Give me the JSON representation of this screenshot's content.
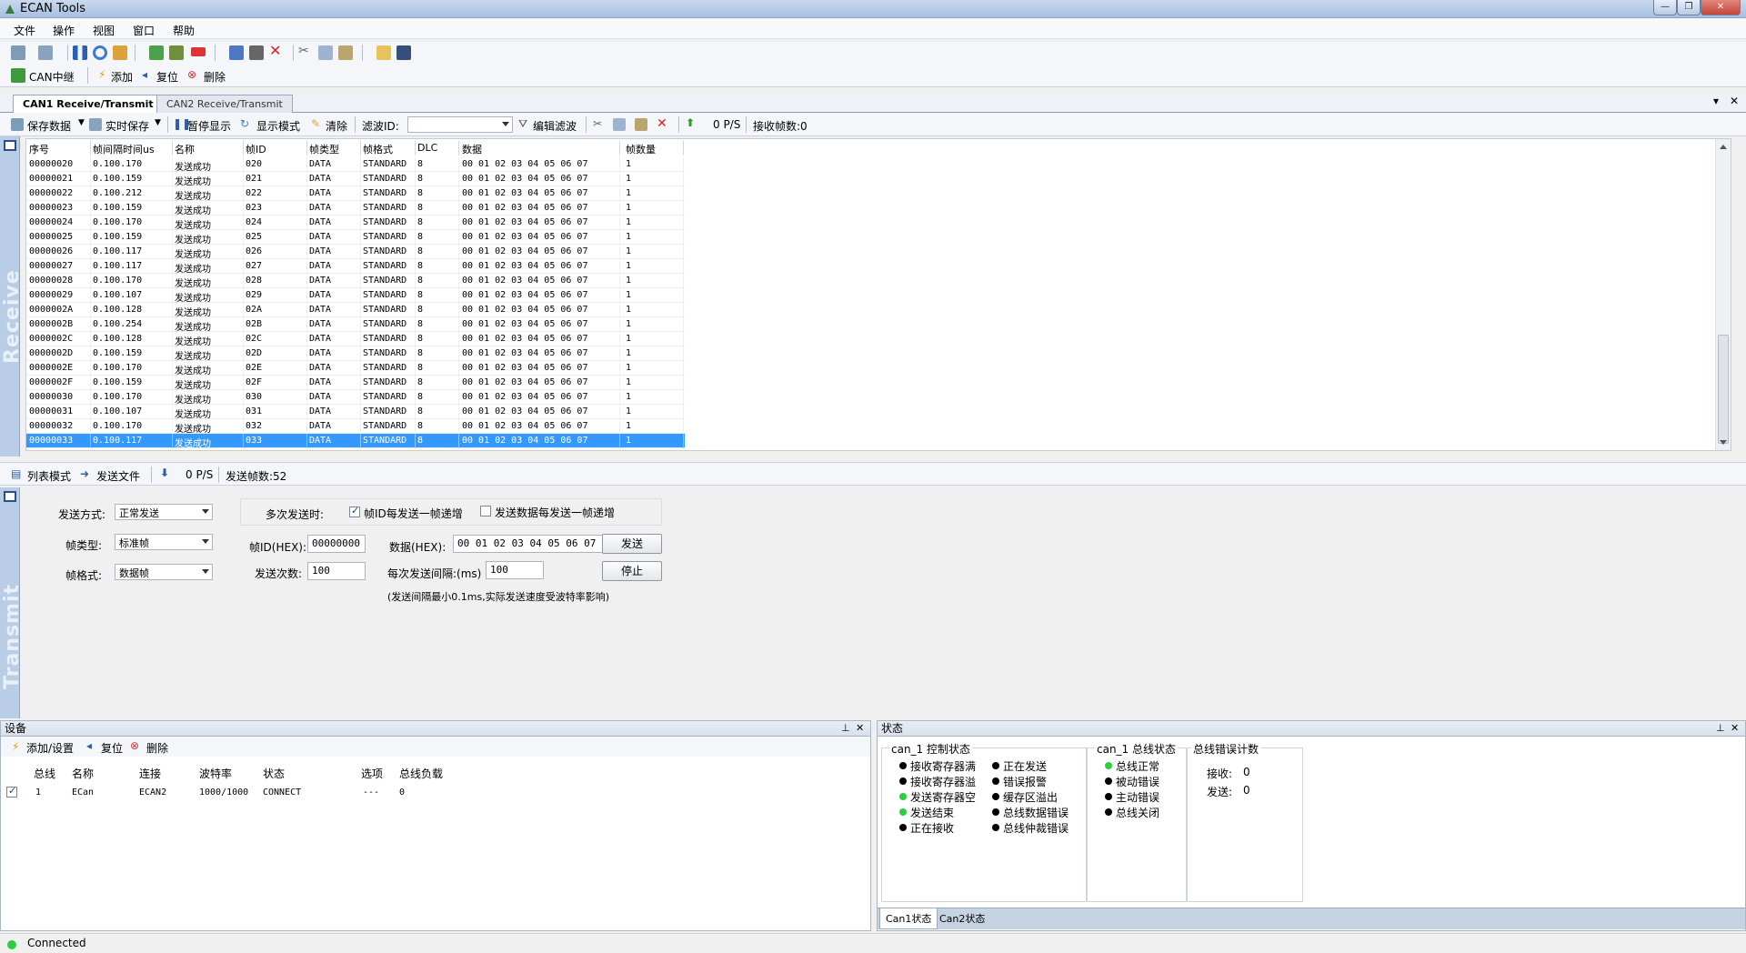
{
  "window": {
    "title": "ECAN Tools"
  },
  "menu": [
    "文件",
    "操作",
    "视图",
    "窗口",
    "帮助"
  ],
  "toolbar2": {
    "can_relay": "CAN中继",
    "add": "添加",
    "reset": "复位",
    "delete": "删除"
  },
  "tabs": {
    "active": "CAN1 Receive/Transmit",
    "inactive": "CAN2 Receive/Transmit"
  },
  "receive_toolbar": {
    "save_data": "保存数据",
    "realtime_save": "实时保存",
    "pause_display": "暂停显示",
    "display_mode": "显示模式",
    "clear": "清除",
    "filter_id_label": "滤波ID:",
    "edit_filter": "编辑滤波",
    "rate": "0 P/S",
    "received_frames": "接收帧数:0"
  },
  "side_labels": {
    "receive": "Receive",
    "transmit": "Transmit"
  },
  "receive_grid": {
    "headers": [
      "序号",
      "帧间隔时间us",
      "名称",
      "帧ID",
      "帧类型",
      "帧格式",
      "DLC",
      "数据",
      "帧数量"
    ],
    "rows": [
      [
        "00000020",
        "0.100.170",
        "发送成功",
        "020",
        "DATA",
        "STANDARD",
        "8",
        "00 01 02 03 04 05 06 07",
        "1"
      ],
      [
        "00000021",
        "0.100.159",
        "发送成功",
        "021",
        "DATA",
        "STANDARD",
        "8",
        "00 01 02 03 04 05 06 07",
        "1"
      ],
      [
        "00000022",
        "0.100.212",
        "发送成功",
        "022",
        "DATA",
        "STANDARD",
        "8",
        "00 01 02 03 04 05 06 07",
        "1"
      ],
      [
        "00000023",
        "0.100.159",
        "发送成功",
        "023",
        "DATA",
        "STANDARD",
        "8",
        "00 01 02 03 04 05 06 07",
        "1"
      ],
      [
        "00000024",
        "0.100.170",
        "发送成功",
        "024",
        "DATA",
        "STANDARD",
        "8",
        "00 01 02 03 04 05 06 07",
        "1"
      ],
      [
        "00000025",
        "0.100.159",
        "发送成功",
        "025",
        "DATA",
        "STANDARD",
        "8",
        "00 01 02 03 04 05 06 07",
        "1"
      ],
      [
        "00000026",
        "0.100.117",
        "发送成功",
        "026",
        "DATA",
        "STANDARD",
        "8",
        "00 01 02 03 04 05 06 07",
        "1"
      ],
      [
        "00000027",
        "0.100.117",
        "发送成功",
        "027",
        "DATA",
        "STANDARD",
        "8",
        "00 01 02 03 04 05 06 07",
        "1"
      ],
      [
        "00000028",
        "0.100.170",
        "发送成功",
        "028",
        "DATA",
        "STANDARD",
        "8",
        "00 01 02 03 04 05 06 07",
        "1"
      ],
      [
        "00000029",
        "0.100.107",
        "发送成功",
        "029",
        "DATA",
        "STANDARD",
        "8",
        "00 01 02 03 04 05 06 07",
        "1"
      ],
      [
        "0000002A",
        "0.100.128",
        "发送成功",
        "02A",
        "DATA",
        "STANDARD",
        "8",
        "00 01 02 03 04 05 06 07",
        "1"
      ],
      [
        "0000002B",
        "0.100.254",
        "发送成功",
        "02B",
        "DATA",
        "STANDARD",
        "8",
        "00 01 02 03 04 05 06 07",
        "1"
      ],
      [
        "0000002C",
        "0.100.128",
        "发送成功",
        "02C",
        "DATA",
        "STANDARD",
        "8",
        "00 01 02 03 04 05 06 07",
        "1"
      ],
      [
        "0000002D",
        "0.100.159",
        "发送成功",
        "02D",
        "DATA",
        "STANDARD",
        "8",
        "00 01 02 03 04 05 06 07",
        "1"
      ],
      [
        "0000002E",
        "0.100.170",
        "发送成功",
        "02E",
        "DATA",
        "STANDARD",
        "8",
        "00 01 02 03 04 05 06 07",
        "1"
      ],
      [
        "0000002F",
        "0.100.159",
        "发送成功",
        "02F",
        "DATA",
        "STANDARD",
        "8",
        "00 01 02 03 04 05 06 07",
        "1"
      ],
      [
        "00000030",
        "0.100.170",
        "发送成功",
        "030",
        "DATA",
        "STANDARD",
        "8",
        "00 01 02 03 04 05 06 07",
        "1"
      ],
      [
        "00000031",
        "0.100.107",
        "发送成功",
        "031",
        "DATA",
        "STANDARD",
        "8",
        "00 01 02 03 04 05 06 07",
        "1"
      ],
      [
        "00000032",
        "0.100.170",
        "发送成功",
        "032",
        "DATA",
        "STANDARD",
        "8",
        "00 01 02 03 04 05 06 07",
        "1"
      ],
      [
        "00000033",
        "0.100.117",
        "发送成功",
        "033",
        "DATA",
        "STANDARD",
        "8",
        "00 01 02 03 04 05 06 07",
        "1"
      ]
    ],
    "selected_row": 19
  },
  "send_toolbar": {
    "list_mode": "列表模式",
    "send_file": "发送文件",
    "rate": "0 P/S",
    "sent_frames": "发送帧数:52"
  },
  "transmit": {
    "send_mode_label": "发送方式:",
    "send_mode_value": "正常发送",
    "multi_send_label": "多次发送时:",
    "frame_id_increment": "帧ID每发送一帧递增",
    "data_increment": "发送数据每发送一帧递增",
    "frame_type_label": "帧类型:",
    "frame_type_value": "标准帧",
    "frame_id_label": "帧ID(HEX):",
    "frame_id_value": "00000000",
    "data_label": "数据(HEX):",
    "data_value": "00 01 02 03 04 05 06 07",
    "send_button": "发送",
    "frame_format_label": "帧格式:",
    "frame_format_value": "数据帧",
    "send_count_label": "发送次数:",
    "send_count_value": "100",
    "interval_label": "每次发送间隔:(ms)",
    "interval_value": "100",
    "stop_button": "停止",
    "note": "(发送间隔最小0.1ms,实际发送速度受波特率影响)"
  },
  "device_panel": {
    "title": "设备",
    "add_setup": "添加/设置",
    "reset": "复位",
    "delete": "删除",
    "headers": [
      "总线",
      "名称",
      "连接",
      "波特率",
      "状态",
      "选项",
      "总线负载"
    ],
    "rows": [
      [
        "1",
        "ECan",
        "ECAN2",
        "1000/1000",
        "CONNECT",
        "---",
        "0"
      ]
    ]
  },
  "status_panel": {
    "title": "状态",
    "control_title": "can_1 控制状态",
    "control_col1": [
      {
        "label": "接收寄存器满",
        "color": "#000000"
      },
      {
        "label": "接收寄存器溢",
        "color": "#000000"
      },
      {
        "label": "发送寄存器空",
        "color": "#2ecc40"
      },
      {
        "label": "发送结束",
        "color": "#2ecc40"
      },
      {
        "label": "正在接收",
        "color": "#000000"
      }
    ],
    "control_col2": [
      {
        "label": "正在发送",
        "color": "#000000"
      },
      {
        "label": "错误报警",
        "color": "#000000"
      },
      {
        "label": "缓存区溢出",
        "color": "#000000"
      },
      {
        "label": "总线数据错误",
        "color": "#000000"
      },
      {
        "label": "总线仲裁错误",
        "color": "#000000"
      }
    ],
    "bus_title": "can_1 总线状态",
    "bus_items": [
      {
        "label": "总线正常",
        "color": "#2ecc40"
      },
      {
        "label": "被动错误",
        "color": "#000000"
      },
      {
        "label": "主动错误",
        "color": "#000000"
      },
      {
        "label": "总线关闭",
        "color": "#000000"
      }
    ],
    "error_title": "总线错误计数",
    "recv_label": "接收:",
    "recv_value": "0",
    "send_label": "发送:",
    "send_value": "0",
    "tab1": "Can1状态",
    "tab2": "Can2状态"
  },
  "status_bar": {
    "text": "Connected"
  }
}
